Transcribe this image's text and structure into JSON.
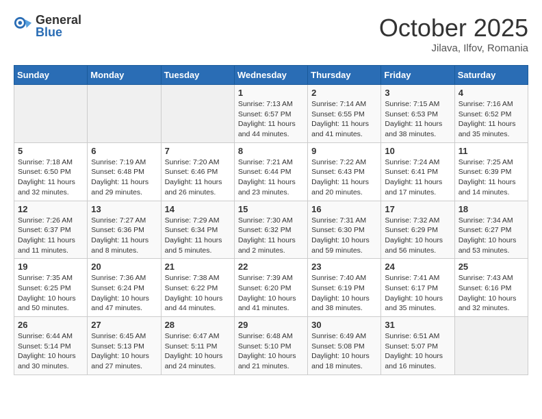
{
  "header": {
    "logo_general": "General",
    "logo_blue": "Blue",
    "month_title": "October 2025",
    "location": "Jilava, Ilfov, Romania"
  },
  "days_of_week": [
    "Sunday",
    "Monday",
    "Tuesday",
    "Wednesday",
    "Thursday",
    "Friday",
    "Saturday"
  ],
  "weeks": [
    [
      {
        "day": "",
        "info": ""
      },
      {
        "day": "",
        "info": ""
      },
      {
        "day": "",
        "info": ""
      },
      {
        "day": "1",
        "info": "Sunrise: 7:13 AM\nSunset: 6:57 PM\nDaylight: 11 hours and 44 minutes."
      },
      {
        "day": "2",
        "info": "Sunrise: 7:14 AM\nSunset: 6:55 PM\nDaylight: 11 hours and 41 minutes."
      },
      {
        "day": "3",
        "info": "Sunrise: 7:15 AM\nSunset: 6:53 PM\nDaylight: 11 hours and 38 minutes."
      },
      {
        "day": "4",
        "info": "Sunrise: 7:16 AM\nSunset: 6:52 PM\nDaylight: 11 hours and 35 minutes."
      }
    ],
    [
      {
        "day": "5",
        "info": "Sunrise: 7:18 AM\nSunset: 6:50 PM\nDaylight: 11 hours and 32 minutes."
      },
      {
        "day": "6",
        "info": "Sunrise: 7:19 AM\nSunset: 6:48 PM\nDaylight: 11 hours and 29 minutes."
      },
      {
        "day": "7",
        "info": "Sunrise: 7:20 AM\nSunset: 6:46 PM\nDaylight: 11 hours and 26 minutes."
      },
      {
        "day": "8",
        "info": "Sunrise: 7:21 AM\nSunset: 6:44 PM\nDaylight: 11 hours and 23 minutes."
      },
      {
        "day": "9",
        "info": "Sunrise: 7:22 AM\nSunset: 6:43 PM\nDaylight: 11 hours and 20 minutes."
      },
      {
        "day": "10",
        "info": "Sunrise: 7:24 AM\nSunset: 6:41 PM\nDaylight: 11 hours and 17 minutes."
      },
      {
        "day": "11",
        "info": "Sunrise: 7:25 AM\nSunset: 6:39 PM\nDaylight: 11 hours and 14 minutes."
      }
    ],
    [
      {
        "day": "12",
        "info": "Sunrise: 7:26 AM\nSunset: 6:37 PM\nDaylight: 11 hours and 11 minutes."
      },
      {
        "day": "13",
        "info": "Sunrise: 7:27 AM\nSunset: 6:36 PM\nDaylight: 11 hours and 8 minutes."
      },
      {
        "day": "14",
        "info": "Sunrise: 7:29 AM\nSunset: 6:34 PM\nDaylight: 11 hours and 5 minutes."
      },
      {
        "day": "15",
        "info": "Sunrise: 7:30 AM\nSunset: 6:32 PM\nDaylight: 11 hours and 2 minutes."
      },
      {
        "day": "16",
        "info": "Sunrise: 7:31 AM\nSunset: 6:30 PM\nDaylight: 10 hours and 59 minutes."
      },
      {
        "day": "17",
        "info": "Sunrise: 7:32 AM\nSunset: 6:29 PM\nDaylight: 10 hours and 56 minutes."
      },
      {
        "day": "18",
        "info": "Sunrise: 7:34 AM\nSunset: 6:27 PM\nDaylight: 10 hours and 53 minutes."
      }
    ],
    [
      {
        "day": "19",
        "info": "Sunrise: 7:35 AM\nSunset: 6:25 PM\nDaylight: 10 hours and 50 minutes."
      },
      {
        "day": "20",
        "info": "Sunrise: 7:36 AM\nSunset: 6:24 PM\nDaylight: 10 hours and 47 minutes."
      },
      {
        "day": "21",
        "info": "Sunrise: 7:38 AM\nSunset: 6:22 PM\nDaylight: 10 hours and 44 minutes."
      },
      {
        "day": "22",
        "info": "Sunrise: 7:39 AM\nSunset: 6:20 PM\nDaylight: 10 hours and 41 minutes."
      },
      {
        "day": "23",
        "info": "Sunrise: 7:40 AM\nSunset: 6:19 PM\nDaylight: 10 hours and 38 minutes."
      },
      {
        "day": "24",
        "info": "Sunrise: 7:41 AM\nSunset: 6:17 PM\nDaylight: 10 hours and 35 minutes."
      },
      {
        "day": "25",
        "info": "Sunrise: 7:43 AM\nSunset: 6:16 PM\nDaylight: 10 hours and 32 minutes."
      }
    ],
    [
      {
        "day": "26",
        "info": "Sunrise: 6:44 AM\nSunset: 5:14 PM\nDaylight: 10 hours and 30 minutes."
      },
      {
        "day": "27",
        "info": "Sunrise: 6:45 AM\nSunset: 5:13 PM\nDaylight: 10 hours and 27 minutes."
      },
      {
        "day": "28",
        "info": "Sunrise: 6:47 AM\nSunset: 5:11 PM\nDaylight: 10 hours and 24 minutes."
      },
      {
        "day": "29",
        "info": "Sunrise: 6:48 AM\nSunset: 5:10 PM\nDaylight: 10 hours and 21 minutes."
      },
      {
        "day": "30",
        "info": "Sunrise: 6:49 AM\nSunset: 5:08 PM\nDaylight: 10 hours and 18 minutes."
      },
      {
        "day": "31",
        "info": "Sunrise: 6:51 AM\nSunset: 5:07 PM\nDaylight: 10 hours and 16 minutes."
      },
      {
        "day": "",
        "info": ""
      }
    ]
  ]
}
